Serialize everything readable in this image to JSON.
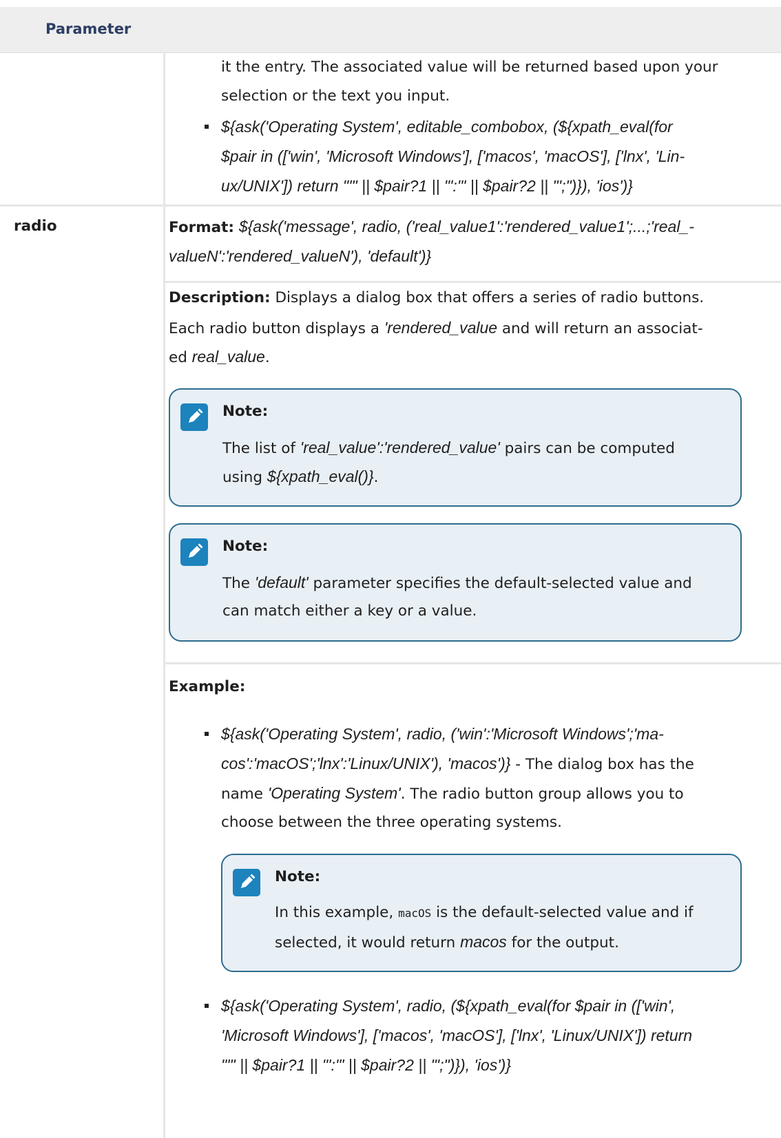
{
  "table": {
    "header": "Parameter",
    "row1": {
      "lines": [
        "it the entry. The associated value will be returned based upon your",
        "selection or the text you input."
      ],
      "bullet_lines": [
        "${ask('Operating System', editable_combobox, (${xpath_eval(for",
        "$pair in (['win', 'Microsoft Windows'], ['macos', 'macOS'], ['lnx', 'Lin-",
        "ux/UNIX']) return \"'\" || $pair?1 || \"':'\" || $pair?2 || \"';\")}), 'ios')}"
      ]
    },
    "row2": {
      "name": "radio",
      "format_label": "Format:",
      "format_line1": "${ask('message', radio, ('real_value1':'rendered_value1';...;'real_-",
      "format_line2": "valueN':'rendered_valueN'), 'default')}",
      "desc_label": "Description:",
      "desc_line1_rest": "Displays a dialog box that offers a series of radio buttons.",
      "desc_line2_a": "Each radio button displays a ",
      "desc_line2_i": "'rendered_value",
      "desc_line2_b": " and will return an associat-",
      "desc_line3_a": "ed ",
      "desc_line3_i": "real_value",
      "desc_line3_b": ".",
      "note1": {
        "title": "Note:",
        "l1_a": "The list of ",
        "l1_i": "'real_value':'rendered_value'",
        "l1_b": " pairs can be computed",
        "l2_a": "using ",
        "l2_i": "${xpath_eval()}",
        "l2_b": "."
      },
      "note2": {
        "title": "Note:",
        "l1_a": "The ",
        "l1_i": "'default'",
        "l1_b": " parameter specifies the default-selected value and",
        "l2": "can match either a key or a value."
      },
      "example_label": "Example:",
      "ex1": {
        "l1": "${ask('Operating System', radio, ('win':'Microsoft Windows';'ma-",
        "l2_i": "cos':'macOS';'lnx':'Linux/UNIX'), 'macos')}",
        "l2_b": " - The dialog box has the",
        "l3_a": "name ",
        "l3_i": "'Operating System'",
        "l3_b": ". The radio button group allows you to",
        "l4": "choose between the three operating systems."
      },
      "note3": {
        "title": "Note:",
        "l1_a": "In this example, ",
        "l1_code": "macOS",
        "l1_b": " is the default-selected value and if",
        "l2_a": "selected, it would return ",
        "l2_i": "macos",
        "l2_b": " for the output."
      },
      "ex2": {
        "l1": "${ask('Operating System', radio, (${xpath_eval(for $pair in (['win',",
        "l2": "'Microsoft Windows'], ['macos', 'macOS'], ['lnx', 'Linux/UNIX']) return",
        "l3": "\"'\" || $pair?1 || \"':'\" || $pair?2 || \"';\")}), 'ios')}"
      }
    }
  },
  "colors": {
    "header_text": "#2c3e63",
    "note_bg": "#e8eff5",
    "note_border": "#2e6c8f",
    "note_icon": "#1c83bd"
  },
  "icons": [
    "note-pencil-icon"
  ]
}
